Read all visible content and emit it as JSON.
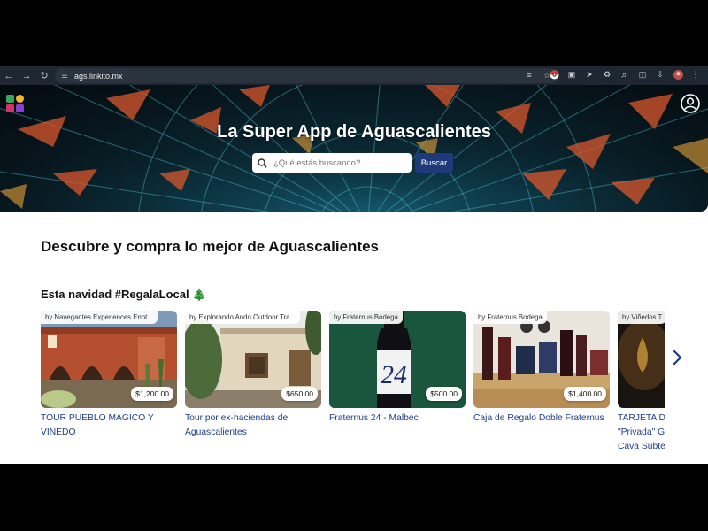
{
  "browser": {
    "url": "ags.linkito.mx"
  },
  "header": {
    "title": "La Super App de Aguascalientes",
    "search_placeholder": "¿Qué estás buscando?",
    "search_button": "Buscar"
  },
  "main": {
    "heading": "Descubre y compra lo mejor de Aguascalientes",
    "section_title": "Esta navidad #RegalaLocal 🎄"
  },
  "products": [
    {
      "vendor": "by Navegantes Experiences Enot...",
      "price": "$1,200.00",
      "title": "TOUR PUEBLO MAGICO Y VIÑEDO"
    },
    {
      "vendor": "by Explorando Ando Outdoor Tra...",
      "price": "$650.00",
      "title": "Tour por ex-haciendas de Aguascalientes"
    },
    {
      "vendor": "by Fraternus Bodega",
      "price": "$500.00",
      "title": "Fraternus 24 - Malbec"
    },
    {
      "vendor": "by Fraternus Bodega",
      "price": "$1,400.00",
      "title": "Caja de Regalo Doble Fraternus"
    },
    {
      "vendor": "by Viñedos T",
      "price": "",
      "title": "TARJETA D \"Privada\" G Cava Subte"
    }
  ],
  "colors": {
    "accent": "#1f3a7a",
    "link": "#1f3d8a"
  }
}
